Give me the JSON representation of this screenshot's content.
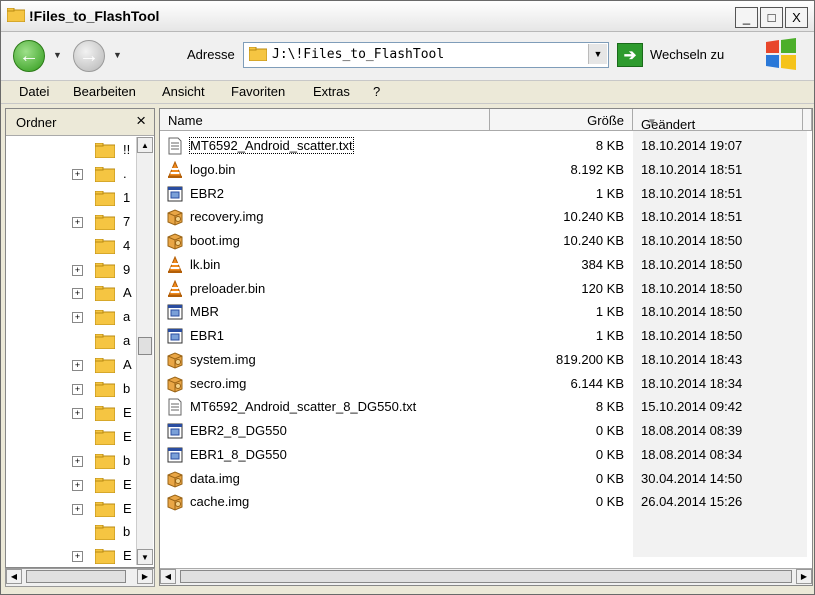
{
  "window": {
    "title": "!Files_to_FlashTool",
    "minimize": "_",
    "maximize": "□",
    "close": "X"
  },
  "toolbar": {
    "back_label": "←",
    "forward_label": "→",
    "address_label": "Adresse",
    "address_value": "J:\\!Files_to_FlashTool",
    "go_label": "Wechseln zu"
  },
  "menu": {
    "items": [
      {
        "label": "Datei"
      },
      {
        "label": "Bearbeiten"
      },
      {
        "label": "Ansicht"
      },
      {
        "label": "Favoriten"
      },
      {
        "label": "Extras"
      },
      {
        "label": "?"
      }
    ]
  },
  "folders_pane": {
    "header": "Ordner",
    "close": "×",
    "items": [
      {
        "label": "!!",
        "expandable": false
      },
      {
        "label": ".",
        "expandable": true
      },
      {
        "label": "1",
        "expandable": false
      },
      {
        "label": "7",
        "expandable": true
      },
      {
        "label": "4",
        "expandable": false
      },
      {
        "label": "9",
        "expandable": true
      },
      {
        "label": "A",
        "expandable": true
      },
      {
        "label": "a",
        "expandable": true
      },
      {
        "label": "a",
        "expandable": false
      },
      {
        "label": "A",
        "expandable": true
      },
      {
        "label": "b",
        "expandable": true
      },
      {
        "label": "E",
        "expandable": true
      },
      {
        "label": "E",
        "expandable": false
      },
      {
        "label": "b",
        "expandable": true
      },
      {
        "label": "E",
        "expandable": true
      },
      {
        "label": "E",
        "expandable": true
      },
      {
        "label": "b",
        "expandable": false
      },
      {
        "label": "E",
        "expandable": true
      }
    ]
  },
  "file_list": {
    "columns": {
      "name": "Name",
      "size": "Größe",
      "date": "Geändert am"
    },
    "files": [
      {
        "name": "MT6592_Android_scatter.txt",
        "size": "8 KB",
        "date": "18.10.2014 19:07",
        "icon": "text-file-icon"
      },
      {
        "name": "logo.bin",
        "size": "8.192 KB",
        "date": "18.10.2014 18:51",
        "icon": "vlc-cone-icon"
      },
      {
        "name": "EBR2",
        "size": "1 KB",
        "date": "18.10.2014 18:51",
        "icon": "system-file-icon"
      },
      {
        "name": "recovery.img",
        "size": "10.240 KB",
        "date": "18.10.2014 18:51",
        "icon": "disk-image-icon"
      },
      {
        "name": "boot.img",
        "size": "10.240 KB",
        "date": "18.10.2014 18:50",
        "icon": "disk-image-icon"
      },
      {
        "name": "lk.bin",
        "size": "384 KB",
        "date": "18.10.2014 18:50",
        "icon": "vlc-cone-icon"
      },
      {
        "name": "preloader.bin",
        "size": "120 KB",
        "date": "18.10.2014 18:50",
        "icon": "vlc-cone-icon"
      },
      {
        "name": "MBR",
        "size": "1 KB",
        "date": "18.10.2014 18:50",
        "icon": "system-file-icon"
      },
      {
        "name": "EBR1",
        "size": "1 KB",
        "date": "18.10.2014 18:50",
        "icon": "system-file-icon"
      },
      {
        "name": "system.img",
        "size": "819.200 KB",
        "date": "18.10.2014 18:43",
        "icon": "disk-image-icon"
      },
      {
        "name": "secro.img",
        "size": "6.144 KB",
        "date": "18.10.2014 18:34",
        "icon": "disk-image-icon"
      },
      {
        "name": "MT6592_Android_scatter_8_DG550.txt",
        "size": "8 KB",
        "date": "15.10.2014 09:42",
        "icon": "text-file-icon"
      },
      {
        "name": "EBR2_8_DG550",
        "size": "0 KB",
        "date": "18.08.2014 08:39",
        "icon": "system-file-icon"
      },
      {
        "name": "EBR1_8_DG550",
        "size": "0 KB",
        "date": "18.08.2014 08:34",
        "icon": "system-file-icon"
      },
      {
        "name": "data.img",
        "size": "0 KB",
        "date": "30.04.2014 14:50",
        "icon": "disk-image-icon"
      },
      {
        "name": "cache.img",
        "size": "0 KB",
        "date": "26.04.2014 15:26",
        "icon": "disk-image-icon"
      }
    ]
  }
}
